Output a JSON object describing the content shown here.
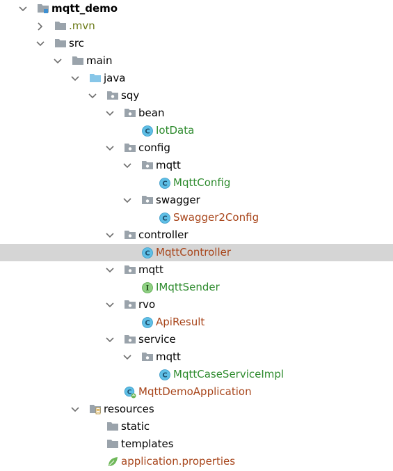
{
  "colors": {
    "folder": "#9aa3ab",
    "source_root": "#87c6e8",
    "class_icon": "#5fbfe6",
    "interface_icon": "#8fd083",
    "spring_icon": "#6fb85a",
    "text_default": "#000000",
    "text_green": "#2e8b2e",
    "text_brown": "#a8461c",
    "text_olive": "#6b7a17",
    "selection": "#d5d5d5"
  },
  "tree": [
    {
      "label": "mqtt_demo",
      "depth": 0,
      "arrow": "down",
      "icon": "module-icon",
      "color": "#000000",
      "bold": true
    },
    {
      "label": ".mvn",
      "depth": 1,
      "arrow": "right",
      "icon": "folder-icon",
      "color": "#6b7a17"
    },
    {
      "label": "src",
      "depth": 1,
      "arrow": "down",
      "icon": "folder-icon",
      "color": "#000000"
    },
    {
      "label": "main",
      "depth": 2,
      "arrow": "down",
      "icon": "folder-icon",
      "color": "#000000"
    },
    {
      "label": "java",
      "depth": 3,
      "arrow": "down",
      "icon": "source-folder-icon",
      "color": "#000000"
    },
    {
      "label": "sqy",
      "depth": 4,
      "arrow": "down",
      "icon": "package-icon",
      "color": "#000000"
    },
    {
      "label": "bean",
      "depth": 5,
      "arrow": "down",
      "icon": "package-icon",
      "color": "#000000"
    },
    {
      "label": "IotData",
      "depth": 6,
      "arrow": "none",
      "icon": "class-icon",
      "color": "#2e8b2e"
    },
    {
      "label": "config",
      "depth": 5,
      "arrow": "down",
      "icon": "package-icon",
      "color": "#000000"
    },
    {
      "label": "mqtt",
      "depth": 6,
      "arrow": "down",
      "icon": "package-icon",
      "color": "#000000"
    },
    {
      "label": "MqttConfig",
      "depth": 7,
      "arrow": "none",
      "icon": "class-icon",
      "color": "#2e8b2e"
    },
    {
      "label": "swagger",
      "depth": 6,
      "arrow": "down",
      "icon": "package-icon",
      "color": "#000000"
    },
    {
      "label": "Swagger2Config",
      "depth": 7,
      "arrow": "none",
      "icon": "class-icon",
      "color": "#a8461c"
    },
    {
      "label": "controller",
      "depth": 5,
      "arrow": "down",
      "icon": "package-icon",
      "color": "#000000"
    },
    {
      "label": "MqttController",
      "depth": 6,
      "arrow": "none",
      "icon": "class-icon",
      "color": "#a8461c",
      "selected": true
    },
    {
      "label": "mqtt",
      "depth": 5,
      "arrow": "down",
      "icon": "package-icon",
      "color": "#000000"
    },
    {
      "label": "IMqttSender",
      "depth": 6,
      "arrow": "none",
      "icon": "interface-icon",
      "color": "#2e8b2e"
    },
    {
      "label": "rvo",
      "depth": 5,
      "arrow": "down",
      "icon": "package-icon",
      "color": "#000000"
    },
    {
      "label": "ApiResult",
      "depth": 6,
      "arrow": "none",
      "icon": "class-icon",
      "color": "#a8461c"
    },
    {
      "label": "service",
      "depth": 5,
      "arrow": "down",
      "icon": "package-icon",
      "color": "#000000"
    },
    {
      "label": "mqtt",
      "depth": 6,
      "arrow": "down",
      "icon": "package-icon",
      "color": "#000000"
    },
    {
      "label": "MqttCaseServiceImpl",
      "depth": 7,
      "arrow": "none",
      "icon": "class-icon",
      "color": "#2e8b2e"
    },
    {
      "label": "MqttDemoApplication",
      "depth": 5,
      "arrow": "none",
      "icon": "spring-boot-class-icon",
      "color": "#a8461c"
    },
    {
      "label": "resources",
      "depth": 3,
      "arrow": "down",
      "icon": "resources-folder-icon",
      "color": "#000000"
    },
    {
      "label": "static",
      "depth": 4,
      "arrow": "none",
      "icon": "folder-icon",
      "color": "#000000"
    },
    {
      "label": "templates",
      "depth": 4,
      "arrow": "none",
      "icon": "folder-icon",
      "color": "#000000"
    },
    {
      "label": "application.properties",
      "depth": 4,
      "arrow": "none",
      "icon": "spring-properties-icon",
      "color": "#a8461c"
    }
  ]
}
